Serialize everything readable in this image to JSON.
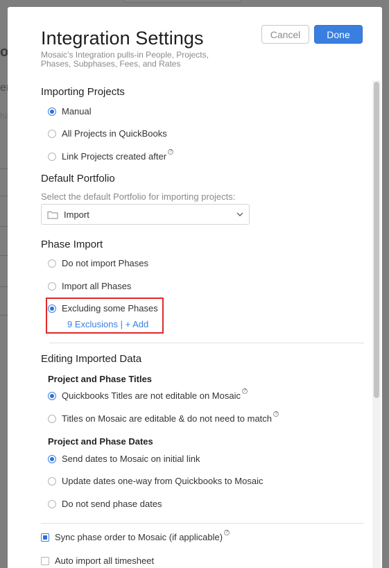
{
  "background": {
    "fragments": [
      "o",
      "er",
      "ha"
    ]
  },
  "modal": {
    "title": "Integration Settings",
    "subtitle": "Mosaic’s Integration pulls-in People, Projects, Phases, Subphases, Fees, and Rates",
    "cancel_label": "Cancel",
    "done_label": "Done"
  },
  "importing_projects": {
    "title": "Importing Projects",
    "options": [
      {
        "label": "Manual",
        "selected": true
      },
      {
        "label": "All Projects in QuickBooks",
        "selected": false
      },
      {
        "label": "Link Projects created after",
        "selected": false,
        "help": true
      }
    ]
  },
  "default_portfolio": {
    "title": "Default Portfolio",
    "hint": "Select the default Portfolio for importing projects:",
    "selected_value": "Import"
  },
  "phase_import": {
    "title": "Phase Import",
    "options": [
      {
        "label": "Do not import Phases",
        "selected": false
      },
      {
        "label": "Import all Phases",
        "selected": false
      },
      {
        "label": "Excluding some Phases",
        "selected": true
      }
    ],
    "exclusions_link": "9 Exclusions",
    "separator": "|",
    "add_link": "+ Add"
  },
  "editing_imported_data": {
    "title": "Editing Imported Data",
    "titles_group": {
      "title": "Project and Phase Titles",
      "options": [
        {
          "label": "Quickbooks Titles are not editable on Mosaic",
          "selected": true,
          "help": true
        },
        {
          "label": "Titles on Mosaic are editable & do not need to match",
          "selected": false,
          "help": true
        }
      ]
    },
    "dates_group": {
      "title": "Project and Phase Dates",
      "options": [
        {
          "label": "Send dates to Mosaic on initial link",
          "selected": true
        },
        {
          "label": "Update dates one-way from Quickbooks to Mosaic",
          "selected": false
        },
        {
          "label": "Do not send phase dates",
          "selected": false
        }
      ]
    }
  },
  "checkboxes": [
    {
      "label": "Sync phase order to Mosaic (if applicable)",
      "checked": true,
      "help": true
    },
    {
      "label": "Auto import all timesheet",
      "checked": false
    }
  ],
  "colors": {
    "accent": "#3a7fe0",
    "highlight": "#e0282b"
  }
}
